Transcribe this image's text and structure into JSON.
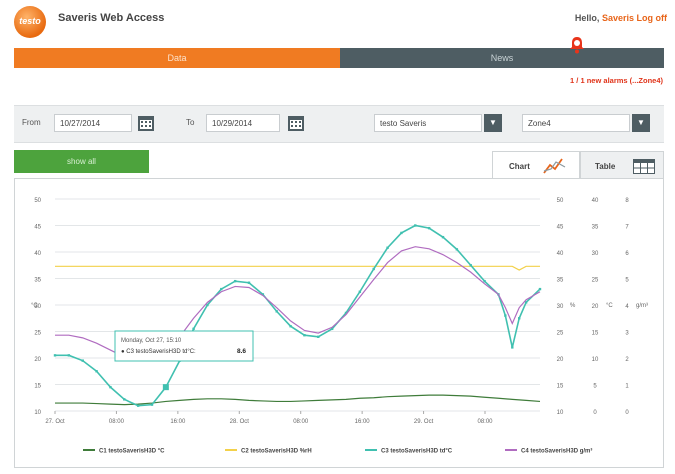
{
  "header": {
    "logo_text": "testo",
    "title": "Saveris Web Access",
    "greeting": "Hello,",
    "user": "Saveris",
    "logout": "Log off"
  },
  "nav": {
    "data_tab": "Data",
    "news_tab": "News"
  },
  "alarm": {
    "link_text": "1 / 1 new alarms (...Zone4)"
  },
  "filter": {
    "from_label": "From",
    "from_value": "10/27/2014",
    "to_label": "To",
    "to_value": "10/29/2014",
    "product": "testo Saveris",
    "zone": "Zone4"
  },
  "show_all": "show all",
  "tabs": {
    "chart": "Chart",
    "table": "Table"
  },
  "colors": {
    "orange": "#f07b22",
    "slate": "#4e5d63",
    "green": "#4da33d",
    "c1": "#3f7c3a",
    "c2": "#f3d14a",
    "c3": "#40c0b0",
    "c4": "#b06cc0"
  },
  "tooltip": {
    "date": "Monday, Oct 27, 15:10",
    "series": "● C3 testoSaverisH3D td°C:",
    "value": "8.6"
  },
  "chart_data": {
    "type": "line",
    "x_tick_labels": [
      "27. Oct",
      "08:00",
      "16:00",
      "28. Oct",
      "08:00",
      "16:00",
      "29. Oct",
      "08:00"
    ],
    "left_axis": {
      "unit": "°C",
      "ticks": [
        10,
        15,
        20,
        25,
        30,
        35,
        40,
        45,
        50
      ]
    },
    "mid_axis": {
      "unit": "%",
      "ticks": [
        10,
        15,
        20,
        25,
        30,
        35,
        40,
        45,
        50
      ]
    },
    "right_axis_1": {
      "unit": "°C",
      "ticks": [
        0,
        5,
        10,
        15,
        20,
        25,
        30,
        35,
        40
      ]
    },
    "right_axis_2": {
      "unit": "g/m³",
      "ticks": [
        0,
        1,
        2,
        3,
        4,
        5,
        6,
        7,
        8
      ]
    },
    "ylim": [
      10,
      50
    ],
    "grid": true,
    "legend_position": "bottom",
    "series": [
      {
        "name": "C1 testoSaverisH3D °C",
        "color": "#3f7c3a",
        "x": [
          0,
          2,
          4,
          6,
          8,
          10,
          12,
          14,
          16,
          18,
          20,
          22,
          24,
          26,
          28,
          30,
          32,
          34,
          36,
          38,
          40,
          42,
          44,
          46,
          48,
          50,
          52,
          54,
          56,
          58,
          60,
          62,
          64,
          66,
          68,
          70
        ],
        "y": [
          11.5,
          11.5,
          11.5,
          11.4,
          11.3,
          11.2,
          11.3,
          11.5,
          11.8,
          12.0,
          12.2,
          12.3,
          12.3,
          12.2,
          12.0,
          11.9,
          11.8,
          11.8,
          11.9,
          12.0,
          12.1,
          12.2,
          12.4,
          12.5,
          12.7,
          12.8,
          12.9,
          13.0,
          13.0,
          12.9,
          12.8,
          12.6,
          12.4,
          12.2,
          12.0,
          11.8
        ]
      },
      {
        "name": "C2 testoSaverisH3D %rH",
        "color": "#f3d14a",
        "x": [
          0,
          10,
          20,
          30,
          40,
          50,
          60,
          66,
          67,
          68,
          70
        ],
        "y": [
          37.3,
          37.3,
          37.3,
          37.3,
          37.3,
          37.3,
          37.3,
          37.3,
          36.6,
          37.3,
          37.3
        ]
      },
      {
        "name": "C3 testoSaverisH3D td°C",
        "color": "#40c0b0",
        "x": [
          0,
          2,
          4,
          6,
          8,
          10,
          12,
          14,
          16,
          18,
          20,
          22,
          24,
          26,
          28,
          30,
          32,
          34,
          36,
          38,
          40,
          42,
          44,
          46,
          48,
          50,
          52,
          54,
          56,
          58,
          60,
          62,
          64,
          65,
          66,
          67,
          68,
          70
        ],
        "y": [
          20.5,
          20.5,
          19.5,
          17.5,
          14.5,
          12.2,
          11.0,
          11.2,
          14.5,
          19.5,
          25.5,
          30.0,
          33.0,
          34.5,
          34.2,
          32.0,
          28.8,
          26.0,
          24.3,
          24.0,
          25.5,
          28.5,
          32.5,
          36.8,
          40.8,
          43.6,
          45.0,
          44.5,
          42.8,
          40.5,
          37.5,
          34.5,
          32.0,
          28.0,
          22.0,
          27.5,
          30.5,
          33.0
        ]
      },
      {
        "name": "C4 testoSaverisH3D g/m³",
        "color": "#b06cc0",
        "x": [
          0,
          2,
          4,
          6,
          8,
          10,
          12,
          14,
          16,
          18,
          20,
          22,
          24,
          26,
          28,
          30,
          32,
          34,
          36,
          38,
          40,
          42,
          44,
          46,
          48,
          50,
          52,
          54,
          56,
          58,
          60,
          62,
          64,
          65,
          66,
          67,
          68,
          70
        ],
        "y": [
          24.3,
          24.3,
          23.8,
          22.8,
          21.5,
          20.2,
          19.5,
          19.8,
          21.5,
          24.0,
          27.5,
          30.5,
          32.5,
          33.5,
          33.3,
          31.8,
          29.5,
          27.0,
          25.2,
          24.7,
          25.8,
          28.2,
          31.5,
          34.8,
          38.0,
          40.2,
          41.0,
          40.6,
          39.5,
          38.0,
          36.2,
          34.0,
          32.0,
          29.5,
          26.5,
          29.5,
          31.0,
          32.5
        ]
      }
    ]
  }
}
